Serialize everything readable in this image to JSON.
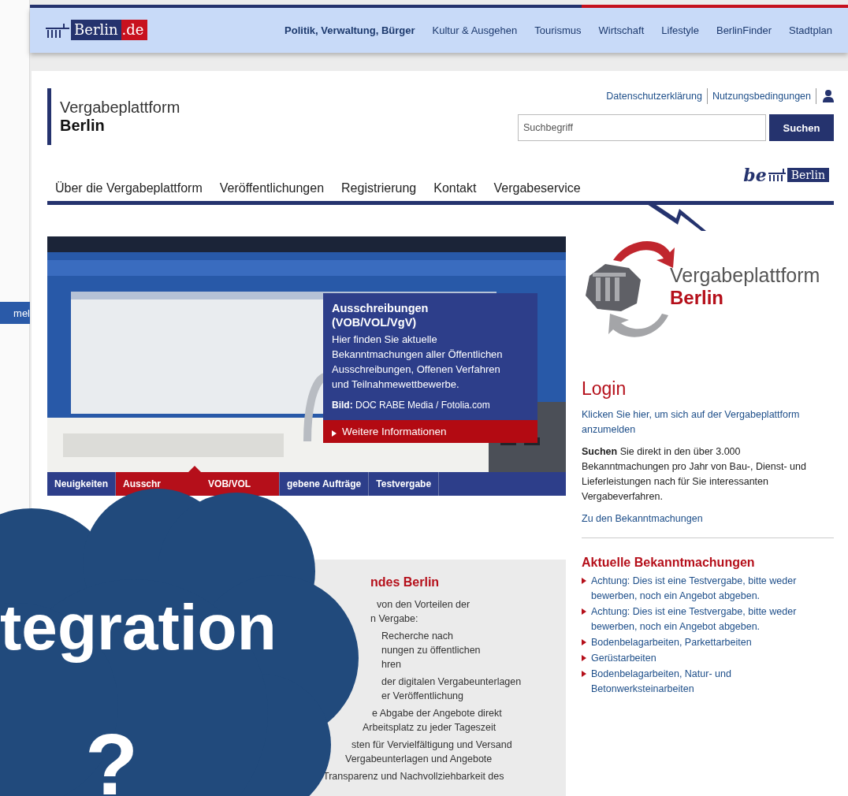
{
  "side_window": {
    "button": "mel"
  },
  "portal_header": {
    "logo": {
      "name": "Berlin",
      "suffix": ".de"
    },
    "nav": [
      {
        "label": "Politik, Verwaltung, Bürger",
        "selected": true
      },
      {
        "label": "Kultur & Ausgehen",
        "selected": false
      },
      {
        "label": "Tourismus",
        "selected": false
      },
      {
        "label": "Wirtschaft",
        "selected": false
      },
      {
        "label": "Lifestyle",
        "selected": false
      },
      {
        "label": "BerlinFinder",
        "selected": false
      },
      {
        "label": "Stadtplan",
        "selected": false
      }
    ]
  },
  "site": {
    "title": "Vergabeplattform",
    "subtitle": "Berlin",
    "links": [
      "Datenschutzerklärung",
      "Nutzungsbedingungen"
    ],
    "search": {
      "placeholder": "Suchbegriff",
      "button": "Suchen"
    },
    "nav": [
      "Über die Vergabeplattform",
      "Veröffentlichungen",
      "Registrierung",
      "Kontakt",
      "Vergabeservice"
    ],
    "be_logo": {
      "prefix": "be",
      "name": "Berlin"
    }
  },
  "hero": {
    "kind": "picture",
    "info": {
      "title": "Ausschreibungen (VOB/VOL/VgV)",
      "text": "Hier finden Sie aktuelle Bekanntmachungen aller Öffentlichen Ausschreibungen, Offenen Verfahren und Teilnahmewettbewerbe.",
      "credit": "**Bild:** DOC RABE Media / Fotolia.com",
      "link": "Weitere Informationen"
    },
    "tabs": [
      {
        "label": "Neuigkeiten",
        "selected": false
      },
      {
        "label": "Ausschr",
        "label_2": "VOB/VOL",
        "selected": true
      },
      {
        "label": "gebene Aufträge",
        "selected": false
      },
      {
        "label": "Testvergabe",
        "selected": false
      }
    ]
  },
  "info_box": {
    "title": "ndes Berlin",
    "lines": [
      "von den Vorteilen der",
      "n Vergabe:",
      "Recherche nach",
      "nungen zu öffentlichen",
      "hren",
      "der digitalen Vergabeunterlagen",
      "er Veröffentlichung",
      "e Abgabe der Angebote direkt",
      "Arbeitsplatz zu jeder Tageszeit",
      "sten für Vervielfältigung und Versand",
      "Vergabeunterlagen und Angebote",
      "Transparenz und Nachvollziehbarkeit des"
    ]
  },
  "sidebar": {
    "logo": {
      "line_1": "Vergabeplattform",
      "line_2": "Berlin"
    },
    "login": {
      "title": "Login",
      "link": "Klicken Sie hier, um sich auf der Vergabeplattform anzumelden",
      "text": "**Suchen** Sie direkt in den über 3.000 Bekanntmachungen pro Jahr von Bau-, Dienst- und Lieferleistungen nach für Sie interessanten Vergabeverfahren.",
      "more": "Zu den Bekanntmachungen"
    },
    "news": {
      "title": "Aktuelle Bekanntmachungen",
      "items": [
        "Achtung: Dies ist eine Testvergabe, bitte weder bewerben, noch ein Angebot abgeben.",
        "Achtung: Dies ist eine Testvergabe, bitte weder bewerben, noch ein Angebot abgeben.",
        "Bodenbelagarbeiten, Parkettarbeiten",
        "Gerüstarbeiten",
        "Bodenbelagarbeiten, Natur- und Betonwerksteinarbeiten"
      ]
    }
  },
  "overlay": {
    "word": "tegration",
    "mark": "?"
  }
}
